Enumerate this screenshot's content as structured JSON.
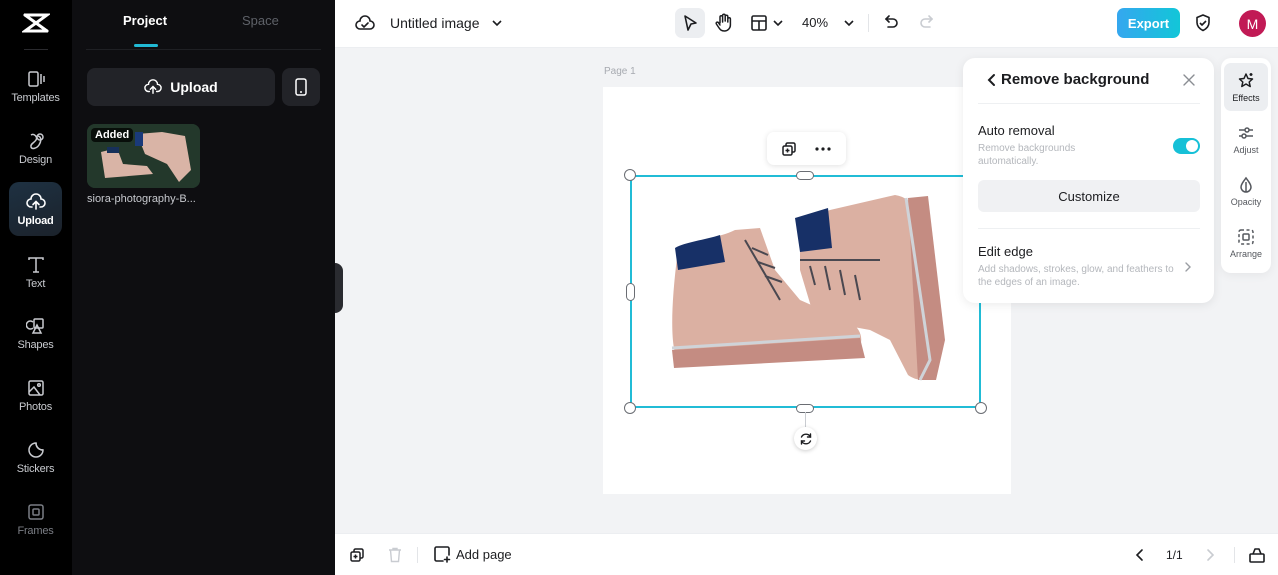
{
  "rail": {
    "items": [
      {
        "label": "Templates",
        "icon": "templates-icon"
      },
      {
        "label": "Design",
        "icon": "design-icon"
      },
      {
        "label": "Upload",
        "icon": "upload-cloud-icon",
        "active": true
      },
      {
        "label": "Text",
        "icon": "text-icon"
      },
      {
        "label": "Shapes",
        "icon": "shapes-icon"
      },
      {
        "label": "Photos",
        "icon": "photos-icon"
      },
      {
        "label": "Stickers",
        "icon": "stickers-icon"
      },
      {
        "label": "Frames",
        "icon": "frames-icon"
      }
    ]
  },
  "panel": {
    "tabs": [
      {
        "label": "Project",
        "active": true
      },
      {
        "label": "Space",
        "active": false
      }
    ],
    "upload_label": "Upload",
    "asset": {
      "badge": "Added",
      "name": "siora-photography-B..."
    }
  },
  "topbar": {
    "title": "Untitled image",
    "zoom": "40%",
    "export_label": "Export",
    "avatar_initial": "M"
  },
  "canvas": {
    "page_label": "Page 1"
  },
  "remove_bg": {
    "title": "Remove background",
    "auto_removal": {
      "label": "Auto removal",
      "description": "Remove backgrounds automatically.",
      "enabled": true
    },
    "customize_label": "Customize",
    "edit_edge": {
      "label": "Edit edge",
      "description": "Add shadows, strokes, glow, and feathers to the edges of an image."
    }
  },
  "right_tools": [
    {
      "label": "Effects",
      "active": true
    },
    {
      "label": "Adjust",
      "active": false
    },
    {
      "label": "Opacity",
      "active": false
    },
    {
      "label": "Arrange",
      "active": false
    }
  ],
  "bottombar": {
    "add_page_label": "Add page",
    "page_count": "1/1"
  },
  "colors": {
    "accent": "#21bcd6",
    "export_gradient_start": "#35a7ef",
    "export_gradient_end": "#12c6d8",
    "avatar": "#c11a55"
  }
}
